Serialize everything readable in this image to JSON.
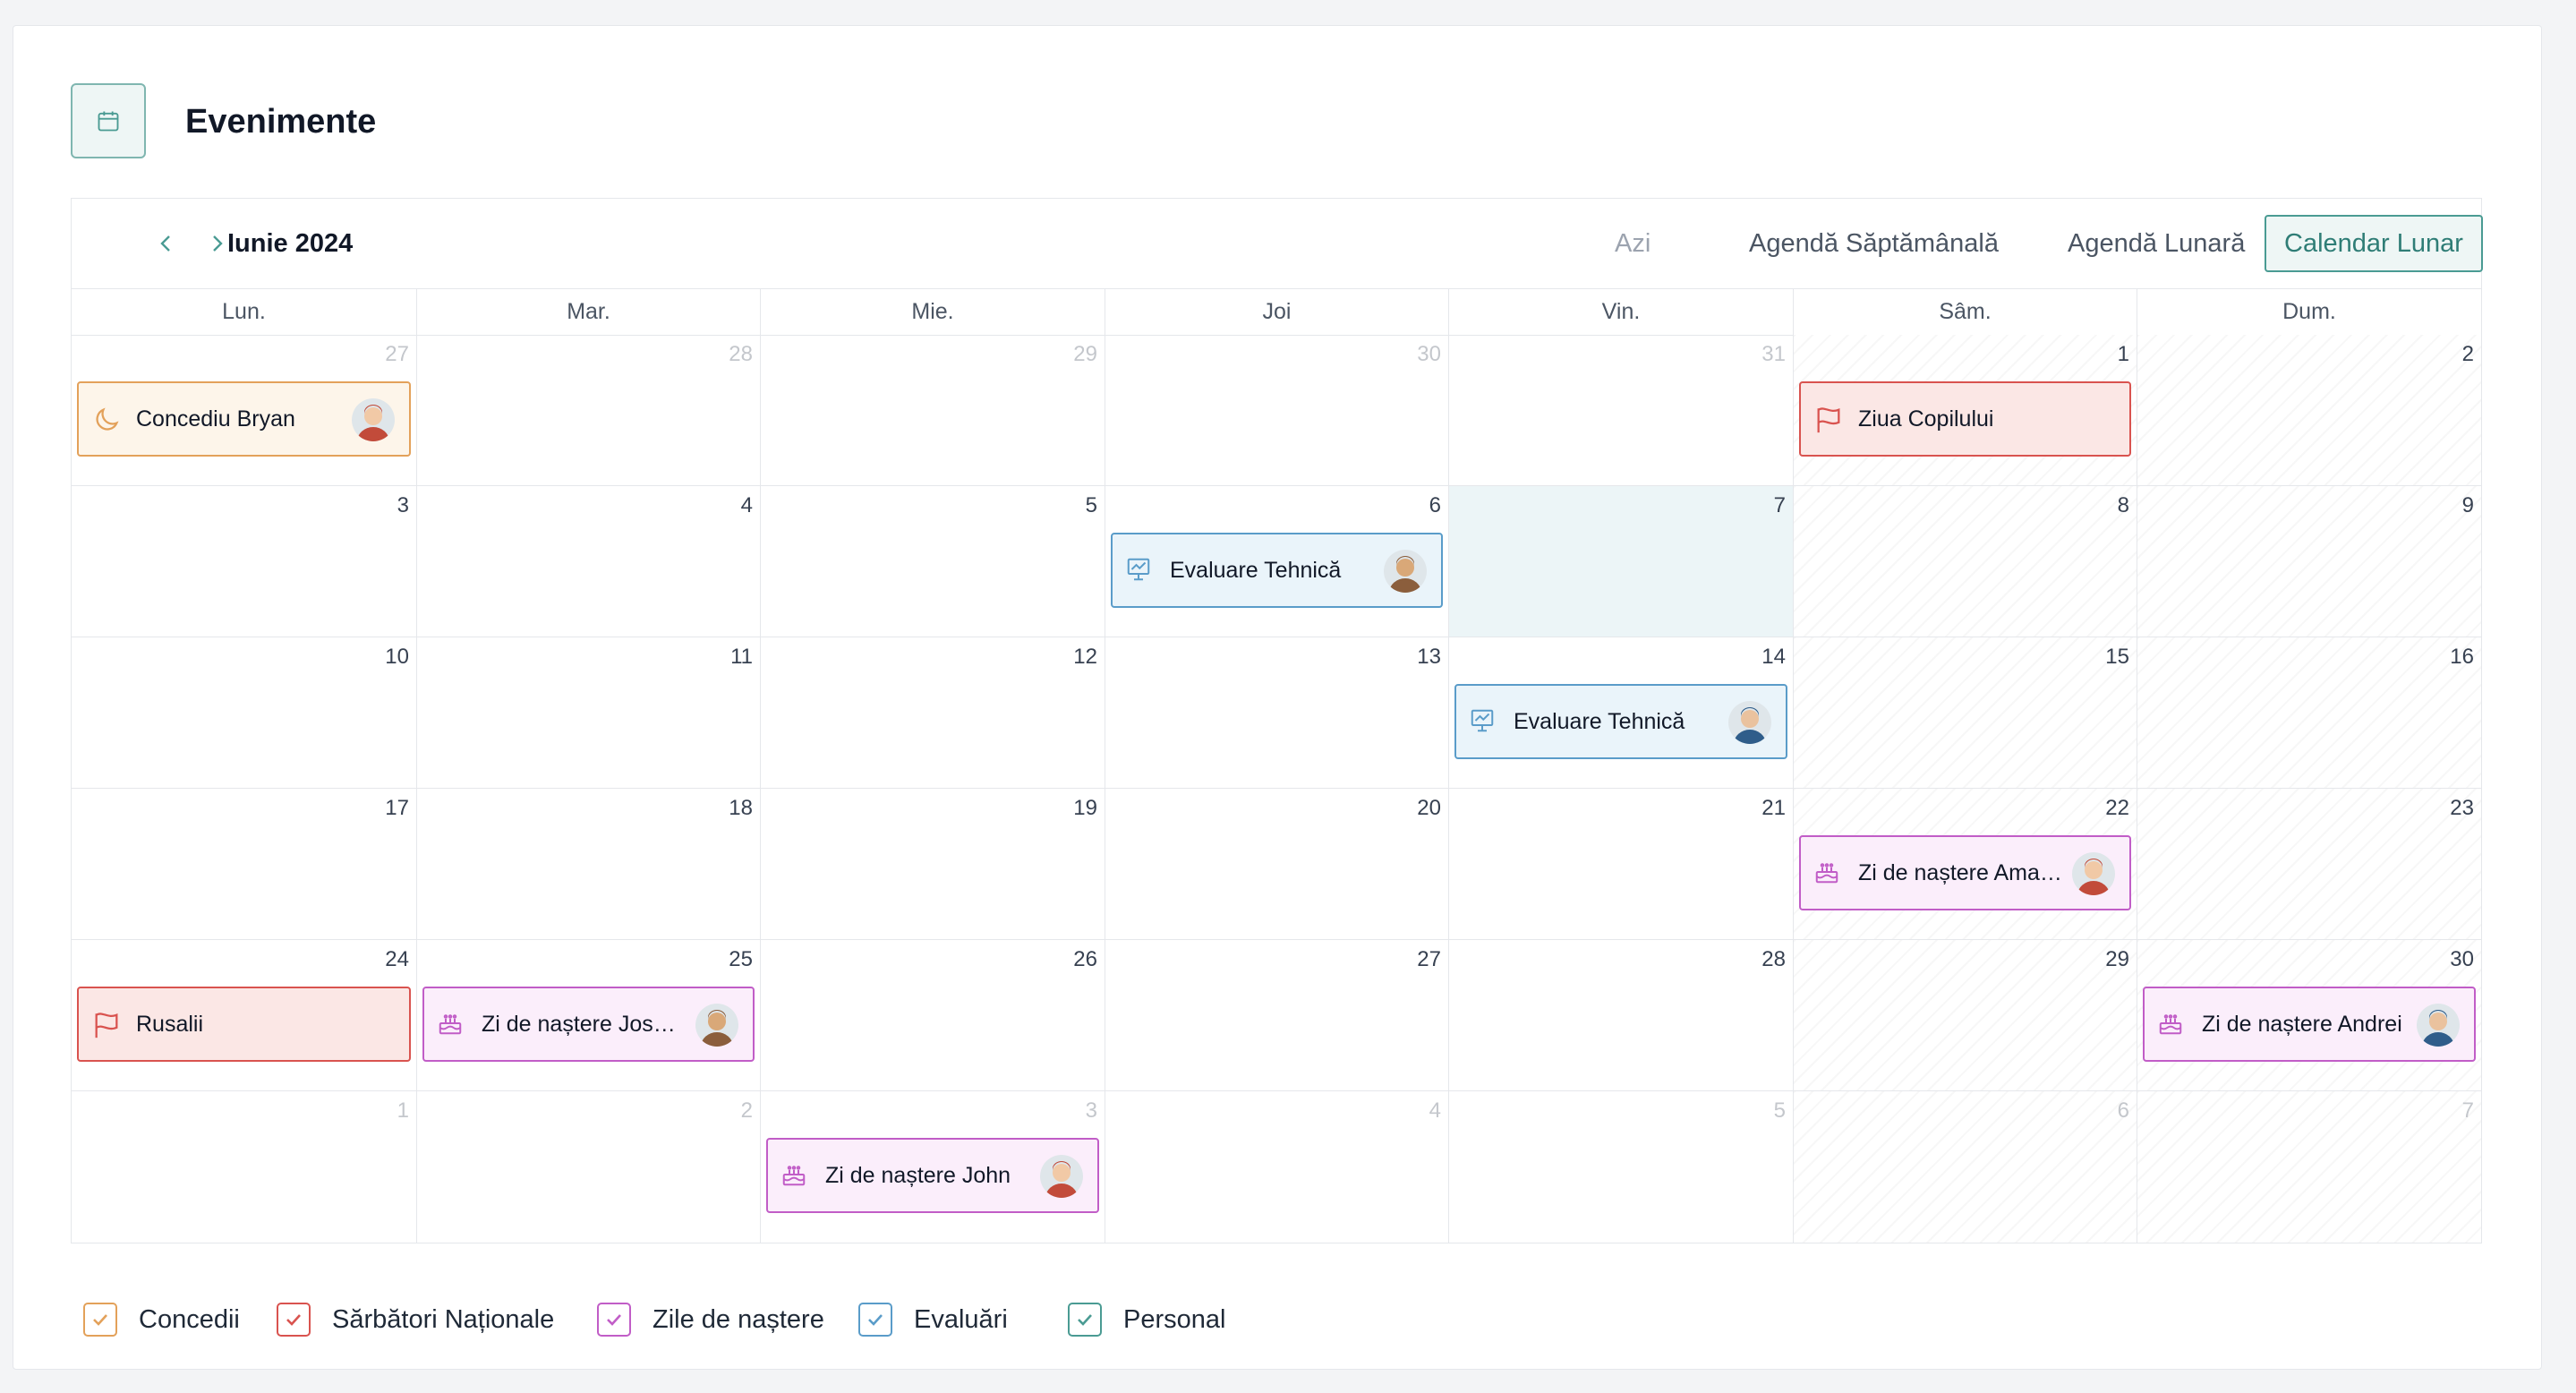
{
  "header": {
    "title": "Evenimente",
    "icon": "calendar-icon"
  },
  "toolbar": {
    "month": "Iunie 2024",
    "prev_icon": "chevron-left-icon",
    "next_icon": "chevron-right-icon",
    "today": "Azi",
    "views": [
      "Agendă Săptămânală",
      "Agendă Lunară",
      "Calendar Lunar"
    ],
    "active_view": "Calendar Lunar"
  },
  "weekdays": [
    "Lun.",
    "Mar.",
    "Mie.",
    "Joi",
    "Vin.",
    "Sâm.",
    "Dum."
  ],
  "weeks": [
    [
      "27",
      "28",
      "29",
      "30",
      "31",
      "1",
      "2"
    ],
    [
      "3",
      "4",
      "5",
      "6",
      "7",
      "8",
      "9"
    ],
    [
      "10",
      "11",
      "12",
      "13",
      "14",
      "15",
      "16"
    ],
    [
      "17",
      "18",
      "19",
      "20",
      "21",
      "22",
      "23"
    ],
    [
      "24",
      "25",
      "26",
      "27",
      "28",
      "29",
      "30"
    ],
    [
      "1",
      "2",
      "3",
      "4",
      "5",
      "6",
      "7"
    ]
  ],
  "events": [
    {
      "title": "Concediu Bryan",
      "category": "orange",
      "icon": "moon-icon",
      "week": 0,
      "day": 0
    },
    {
      "title": "Ziua Copilului",
      "category": "red",
      "icon": "flag-icon",
      "week": 0,
      "day": 5
    },
    {
      "title": "Evaluare Tehnică",
      "category": "blue",
      "icon": "presentation-icon",
      "week": 1,
      "day": 3
    },
    {
      "title": "Evaluare Tehnică",
      "category": "blue",
      "icon": "presentation-icon",
      "week": 2,
      "day": 4
    },
    {
      "title": "Zi de naștere Amanda",
      "category": "pink",
      "icon": "cake-icon",
      "week": 3,
      "day": 5
    },
    {
      "title": "Rusalii",
      "category": "red",
      "icon": "flag-icon",
      "week": 4,
      "day": 0
    },
    {
      "title": "Zi de naștere Joshua",
      "category": "pink",
      "icon": "cake-icon",
      "week": 4,
      "day": 1
    },
    {
      "title": "Zi de naștere Andrei",
      "category": "pink",
      "icon": "cake-icon",
      "week": 4,
      "day": 6
    },
    {
      "title": "Zi de naștere John",
      "category": "pink",
      "icon": "cake-icon",
      "week": 5,
      "day": 2
    }
  ],
  "legend": [
    {
      "label": "Concedii",
      "color": "#e3a15a"
    },
    {
      "label": "Sărbători Naționale",
      "color": "#d9534f"
    },
    {
      "label": "Zile de naștere",
      "color": "#c15dc7"
    },
    {
      "label": "Evaluări",
      "color": "#5a9cc9"
    },
    {
      "label": "Personal",
      "color": "#4a9b93"
    }
  ],
  "colors": {
    "accent": "#4a9b93",
    "today_bg": "#ecf5f7"
  }
}
